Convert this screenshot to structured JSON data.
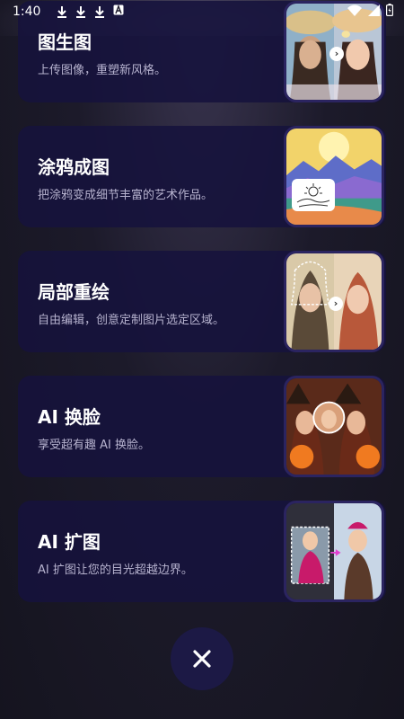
{
  "status_bar": {
    "time": "1:40",
    "icons": [
      "download-icon",
      "download-icon",
      "download-icon",
      "a-icon",
      "wifi-icon",
      "signal-icon",
      "battery-icon"
    ]
  },
  "cards": [
    {
      "title": "图生图",
      "desc": "上传图像，重塑新风格。",
      "thumb": "image-to-image"
    },
    {
      "title": "涂鸦成图",
      "desc": "把涂鸦变成细节丰富的艺术作品。",
      "thumb": "sketch-to-art"
    },
    {
      "title": "局部重绘",
      "desc": "自由编辑，创意定制图片选定区域。",
      "thumb": "inpainting"
    },
    {
      "title": "AI 换脸",
      "desc": "享受超有趣 AI 换脸。",
      "thumb": "face-swap"
    },
    {
      "title": "AI 扩图",
      "desc": "AI 扩图让您的目光超越边界。",
      "thumb": "outpainting"
    }
  ],
  "close_button": {
    "icon": "close-icon",
    "label": "✕"
  },
  "colors": {
    "card_bg": "#16123c",
    "accent_border": "#2b2460",
    "desc_text": "#b7b3cf"
  }
}
